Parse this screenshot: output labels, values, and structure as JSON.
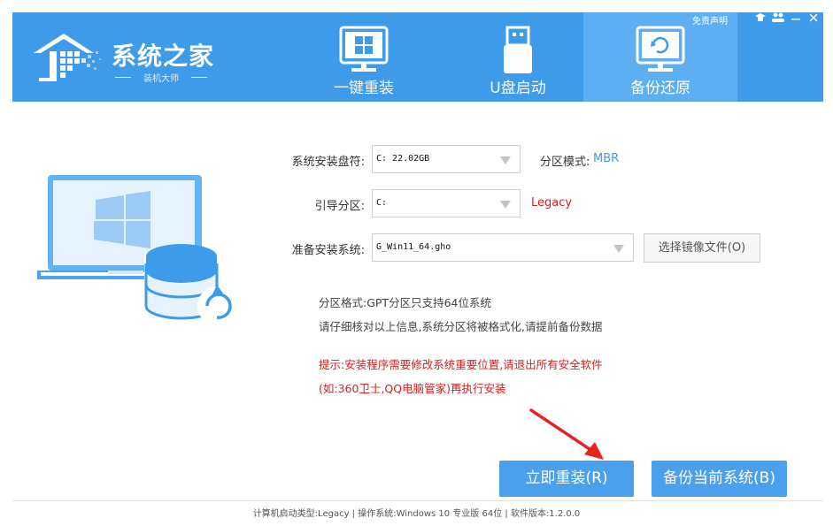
{
  "header": {
    "logo_title": "系统之家",
    "logo_subtitle": "装机大师",
    "disclaimer": "免责声明",
    "tabs": [
      {
        "label": "一键重装",
        "icon": "windows-monitor-icon",
        "active": false
      },
      {
        "label": "U盘启动",
        "icon": "usb-drive-icon",
        "active": false
      },
      {
        "label": "备份还原",
        "icon": "backup-restore-icon",
        "active": true
      }
    ]
  },
  "form": {
    "system_disk_label": "系统安装盘符:",
    "system_disk_value": "C: 22.02GB",
    "partition_mode_label": "分区模式:",
    "partition_mode_value": "MBR",
    "boot_partition_label": "引导分区:",
    "boot_partition_value": "C:",
    "boot_mode_value": "Legacy",
    "image_label": "准备安装系统:",
    "image_value": "G_Win11_64.gho",
    "browse_button": "选择镜像文件(O)"
  },
  "info": {
    "format_line": "分区格式:GPT分区只支持64位系统",
    "check_line": "请仔细核对以上信息,系统分区将被格式化,请提前备份数据",
    "warning_line1": "提示:安装程序需要修改系统重要位置,请退出所有安全软件",
    "warning_line2": "(如:360卫士,QQ电脑管家)再执行安装"
  },
  "actions": {
    "reinstall_button": "立即重装(R)",
    "backup_button": "备份当前系统(B)"
  },
  "footer": {
    "status": "计算机启动类型:Legacy | 操作系统:Windows 10 专业版 64位 | 软件版本:1.2.0.0"
  },
  "colors": {
    "brand_blue": "#3d9be9",
    "active_tab": "#5eaff1",
    "button_blue": "#4aa0ec",
    "warning_red": "#d8201e"
  }
}
